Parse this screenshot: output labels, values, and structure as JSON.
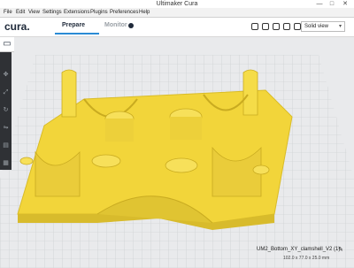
{
  "window": {
    "title": "Ultimaker Cura",
    "min": "—",
    "max": "□",
    "close": "✕"
  },
  "menu": [
    "File",
    "Edit",
    "View",
    "Settings",
    "Extensions",
    "Plugins",
    "Preferences",
    "Help"
  ],
  "header": {
    "logo": "cura.",
    "tabs": [
      {
        "label": "Prepare",
        "active": true
      },
      {
        "label": "Monitor",
        "active": false
      }
    ],
    "view_mode": "Solid view",
    "accent": "#2a8bd5"
  },
  "toolbar": {
    "open_icon": "folder-open-icon",
    "tools": [
      "move-icon",
      "scale-icon",
      "rotate-icon",
      "mirror-icon",
      "per-model-settings-icon",
      "support-blocker-icon"
    ]
  },
  "model": {
    "name": "UM2_Bottom_XY_clamshell_V2 (1)",
    "dimensions": "102.0 x 77.0 x 25.0 mm",
    "color": "#f5de4a"
  }
}
